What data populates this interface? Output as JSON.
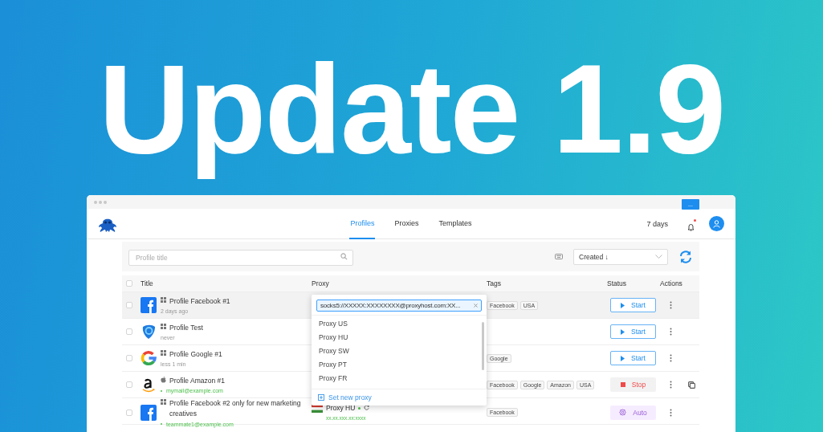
{
  "headline": "Update 1.9",
  "window": {
    "menu_button": "...",
    "tabs": [
      {
        "label": "Profiles",
        "selected": true
      },
      {
        "label": "Proxies",
        "selected": false
      },
      {
        "label": "Templates",
        "selected": false
      }
    ],
    "subscription": "7 days",
    "notifications_unread": true
  },
  "toolbar": {
    "search": {
      "placeholder": "Profile title"
    },
    "sort": {
      "value": "Created ↓"
    }
  },
  "table": {
    "columns": [
      "Title",
      "Proxy",
      "Tags",
      "Status",
      "Actions"
    ],
    "all_checked": false,
    "rows": [
      {
        "logo": {
          "kind": "facebook"
        },
        "os": {
          "kind": "windows"
        },
        "title": "Profile Facebook #1",
        "subtitle": {
          "kind": "time",
          "text": "2 days ago"
        },
        "checked": false,
        "hovered": true,
        "proxy": null,
        "tags": [
          "Facebook",
          "USA"
        ],
        "status": {
          "kind": "start",
          "label": "Start"
        },
        "shared": false
      },
      {
        "logo": {
          "kind": "app"
        },
        "os": {
          "kind": "windows"
        },
        "title": "Profile Test",
        "subtitle": {
          "kind": "time",
          "text": "never"
        },
        "checked": false,
        "hovered": false,
        "proxy": null,
        "tags": [],
        "status": {
          "kind": "start",
          "label": "Start"
        },
        "shared": false
      },
      {
        "logo": {
          "kind": "google"
        },
        "os": {
          "kind": "windows"
        },
        "title": "Profile Google #1",
        "subtitle": {
          "kind": "time",
          "text": "less 1 min"
        },
        "checked": false,
        "hovered": false,
        "proxy": null,
        "tags": [
          "Google"
        ],
        "status": {
          "kind": "start",
          "label": "Start"
        },
        "shared": false
      },
      {
        "logo": {
          "kind": "amazon"
        },
        "os": {
          "kind": "apple"
        },
        "title": "Profile Amazon #1",
        "subtitle": {
          "kind": "email",
          "text": "mymail@example.com"
        },
        "checked": false,
        "hovered": false,
        "proxy": null,
        "tags": [
          "Facebook",
          "Google",
          "Amazon",
          "USA"
        ],
        "status": {
          "kind": "stop",
          "label": "Stop"
        },
        "shared": true
      },
      {
        "logo": {
          "kind": "facebook"
        },
        "os": {
          "kind": "windows"
        },
        "title": "Profile Facebook #2 only for new marketing creatives",
        "subtitle": {
          "kind": "email",
          "text": "teammate1@example.com"
        },
        "checked": false,
        "hovered": false,
        "proxy": {
          "name": "Proxy HU",
          "flag": {
            "kind": "hu"
          },
          "online": true,
          "address": "xx.xx.xxx.xx:xxxx"
        },
        "tags": [
          "Facebook"
        ],
        "status": {
          "kind": "auto",
          "label": "Auto"
        },
        "shared": false
      }
    ]
  },
  "proxy_menu": {
    "value": "socks5://XXXXX:XXXXXXXX@proxyhost.com:XX...",
    "options": [
      "Proxy US",
      "Proxy HU",
      "Proxy SW",
      "Proxy PT",
      "Proxy FR"
    ],
    "action": "Set new proxy"
  }
}
